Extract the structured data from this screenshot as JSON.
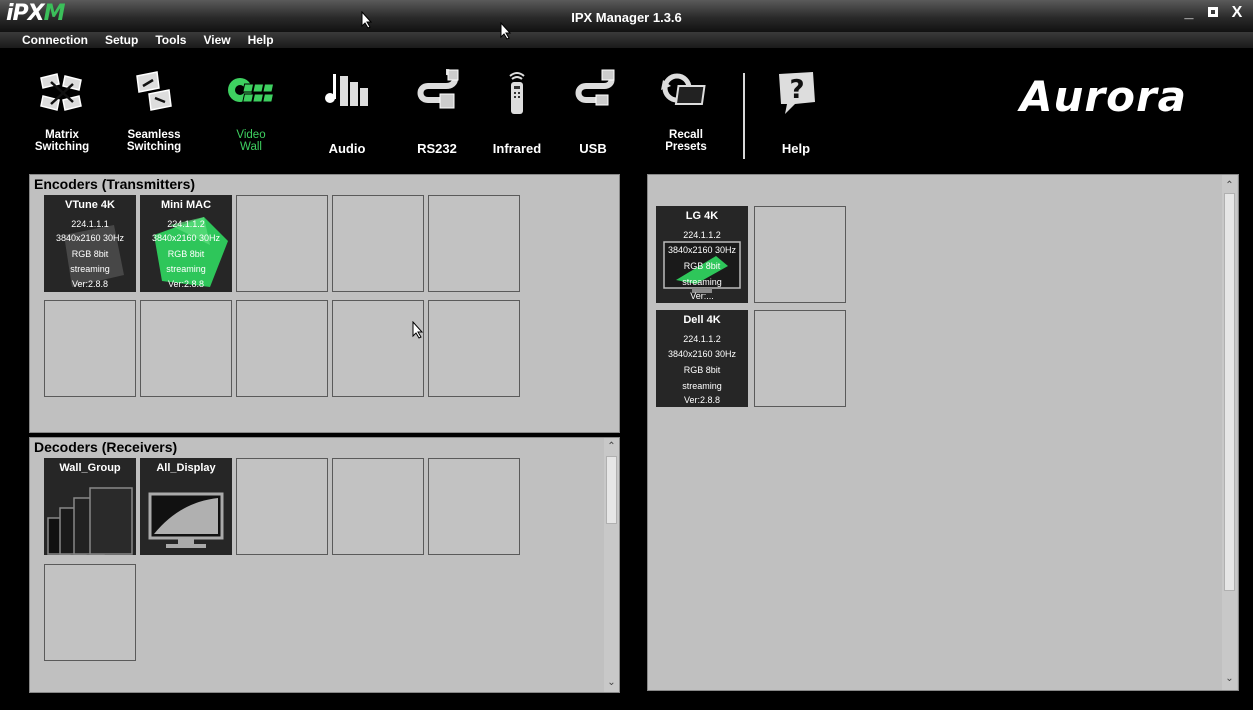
{
  "window": {
    "logo_main": "iPX",
    "logo_accent": "M",
    "title": "IPX Manager 1.3.6",
    "minimize_label": "_",
    "close_label": "X"
  },
  "menu": [
    "Connection",
    "Setup",
    "Tools",
    "View",
    "Help"
  ],
  "toolbar": {
    "items": [
      {
        "label": "Matrix\nSwitching",
        "icon": "matrix-switching-icon"
      },
      {
        "label": "Seamless\nSwitching",
        "icon": "seamless-switching-icon"
      },
      {
        "label": "Video\nWall",
        "icon": "video-wall-icon",
        "active": true
      },
      {
        "label": "Audio",
        "icon": "audio-icon"
      },
      {
        "label": "RS232",
        "icon": "rs232-icon"
      },
      {
        "label": "Infrared",
        "icon": "infrared-remote-icon"
      },
      {
        "label": "USB",
        "icon": "usb-icon"
      },
      {
        "label": "Recall\nPresets",
        "icon": "recall-presets-icon"
      },
      {
        "label": "Help",
        "icon": "help-icon"
      }
    ],
    "brand": "Aurora",
    "accent_color": "#3ed060"
  },
  "encoders": {
    "title": "Encoders (Transmitters)",
    "devices": [
      {
        "name": "VTune 4K",
        "ip": "224.1.1.1",
        "resolution": "3840x2160 30Hz",
        "color": "RGB 8bit",
        "status": "streaming",
        "version": "Ver:2.8.8"
      },
      {
        "name": "Mini MAC",
        "ip": "224.1.1.2",
        "resolution": "3840x2160 30Hz",
        "color": "RGB 8bit",
        "status": "streaming",
        "version": "Ver:2.8.8"
      }
    ]
  },
  "decoders": {
    "title": "Decoders (Receivers)",
    "groups": [
      {
        "name": "Wall_Group",
        "icon": "stacked-displays-icon"
      },
      {
        "name": "All_Display",
        "icon": "monitor-icon"
      }
    ]
  },
  "wall": {
    "devices": [
      {
        "name": "LG 4K",
        "ip": "224.1.1.2",
        "resolution": "3840x2160 30Hz",
        "color": "RGB 8bit",
        "status": "streaming",
        "version": "Ver:..."
      },
      {
        "name": "Dell 4K",
        "ip": "224.1.1.2",
        "resolution": "3840x2160 30Hz",
        "color": "RGB 8bit",
        "status": "streaming",
        "version": "Ver:2.8.8"
      }
    ]
  }
}
